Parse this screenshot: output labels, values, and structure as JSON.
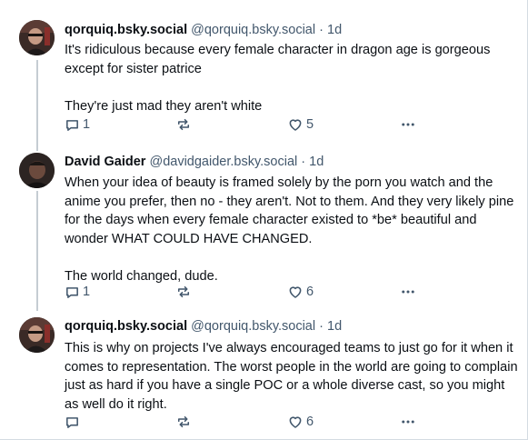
{
  "posts": [
    {
      "display_name": "qorquiq.bsky.social",
      "handle": "@qorquiq.bsky.social",
      "separator": "·",
      "time": "1d",
      "paragraphs": [
        "It's ridiculous because every female character in dragon age is gorgeous except for sister patrice",
        "They're just mad they aren't white"
      ],
      "replies": "1",
      "reposts": "",
      "likes": "5"
    },
    {
      "display_name": "David Gaider",
      "handle": "@davidgaider.bsky.social",
      "separator": "·",
      "time": "1d",
      "paragraphs": [
        "When your idea of beauty is framed solely by the porn you watch and the anime you prefer, then no - they aren't. Not to them. And they very likely pine for the days when every female character existed to *be* beautiful and wonder WHAT COULD HAVE CHANGED.",
        "The world changed, dude."
      ],
      "replies": "1",
      "reposts": "",
      "likes": "6"
    },
    {
      "display_name": "qorquiq.bsky.social",
      "handle": "@qorquiq.bsky.social",
      "separator": "·",
      "time": "1d",
      "paragraphs": [
        "This is why on projects I've always encouraged teams to just go for it when it comes to representation. The worst people in the world are going to complain just as hard if you have a single POC or a whole diverse cast, so you might as well do it right."
      ],
      "replies": "",
      "reposts": "",
      "likes": "6"
    }
  ],
  "icons": {
    "reply": "reply-bubble-icon",
    "repost": "repost-arrows-icon",
    "like": "heart-icon",
    "more": "more-dots-icon"
  },
  "colors": {
    "text": "#0b0f14",
    "muted": "#42576c",
    "thread_line": "#c5ccd3"
  }
}
